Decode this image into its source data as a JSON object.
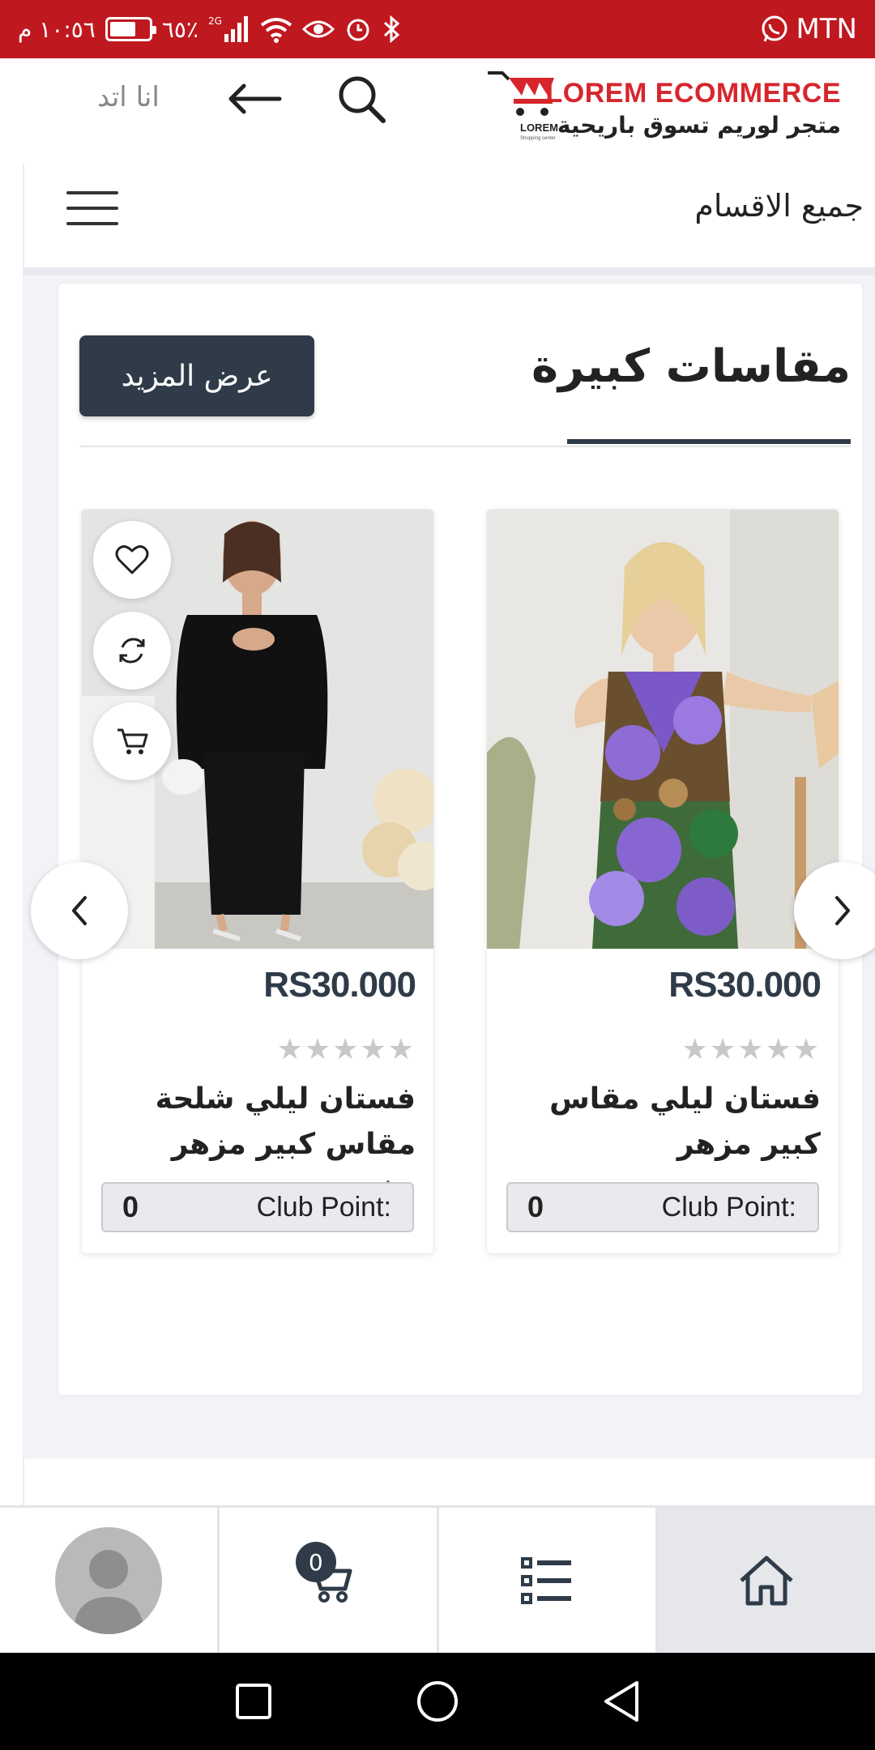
{
  "status_bar": {
    "time": "١٠:٥٦ م",
    "battery_text": "٦٥٪",
    "network": "2G",
    "carrier": "MTN",
    "battery_level": 0.65
  },
  "header": {
    "logo_en": "LOREM ECOMMERCE",
    "logo_ar": "متجر لوريم تسوق باريحية",
    "logo_mark_text": "LOREM",
    "logo_mark_subtext": "Shopping center",
    "user_label": "انا اتد"
  },
  "category_bar": {
    "title": "جميع الاقسام"
  },
  "section": {
    "title": "مقاسات كبيرة",
    "more_button": "عرض المزيد"
  },
  "products": [
    {
      "price": "RS30.000",
      "stars": "★★★★★",
      "rating": 0,
      "name": "فستان ليلي مقاس كبير مزهر",
      "club_label": "Club Point:",
      "club_value": "0"
    },
    {
      "price": "RS30.000",
      "stars": "★★★★★",
      "rating": 0,
      "name": "فستان ليلي شلحة مقاس كبير مزهر وفهد",
      "club_label": "Club Point:",
      "club_value": "0"
    }
  ],
  "bottom_nav": {
    "cart_count": "0",
    "items": [
      "profile",
      "cart",
      "categories",
      "home"
    ],
    "active": "home"
  },
  "colors": {
    "status_bar": "#c0181f",
    "brand_red": "#d6262c",
    "primary_dark": "#2f3b48"
  }
}
